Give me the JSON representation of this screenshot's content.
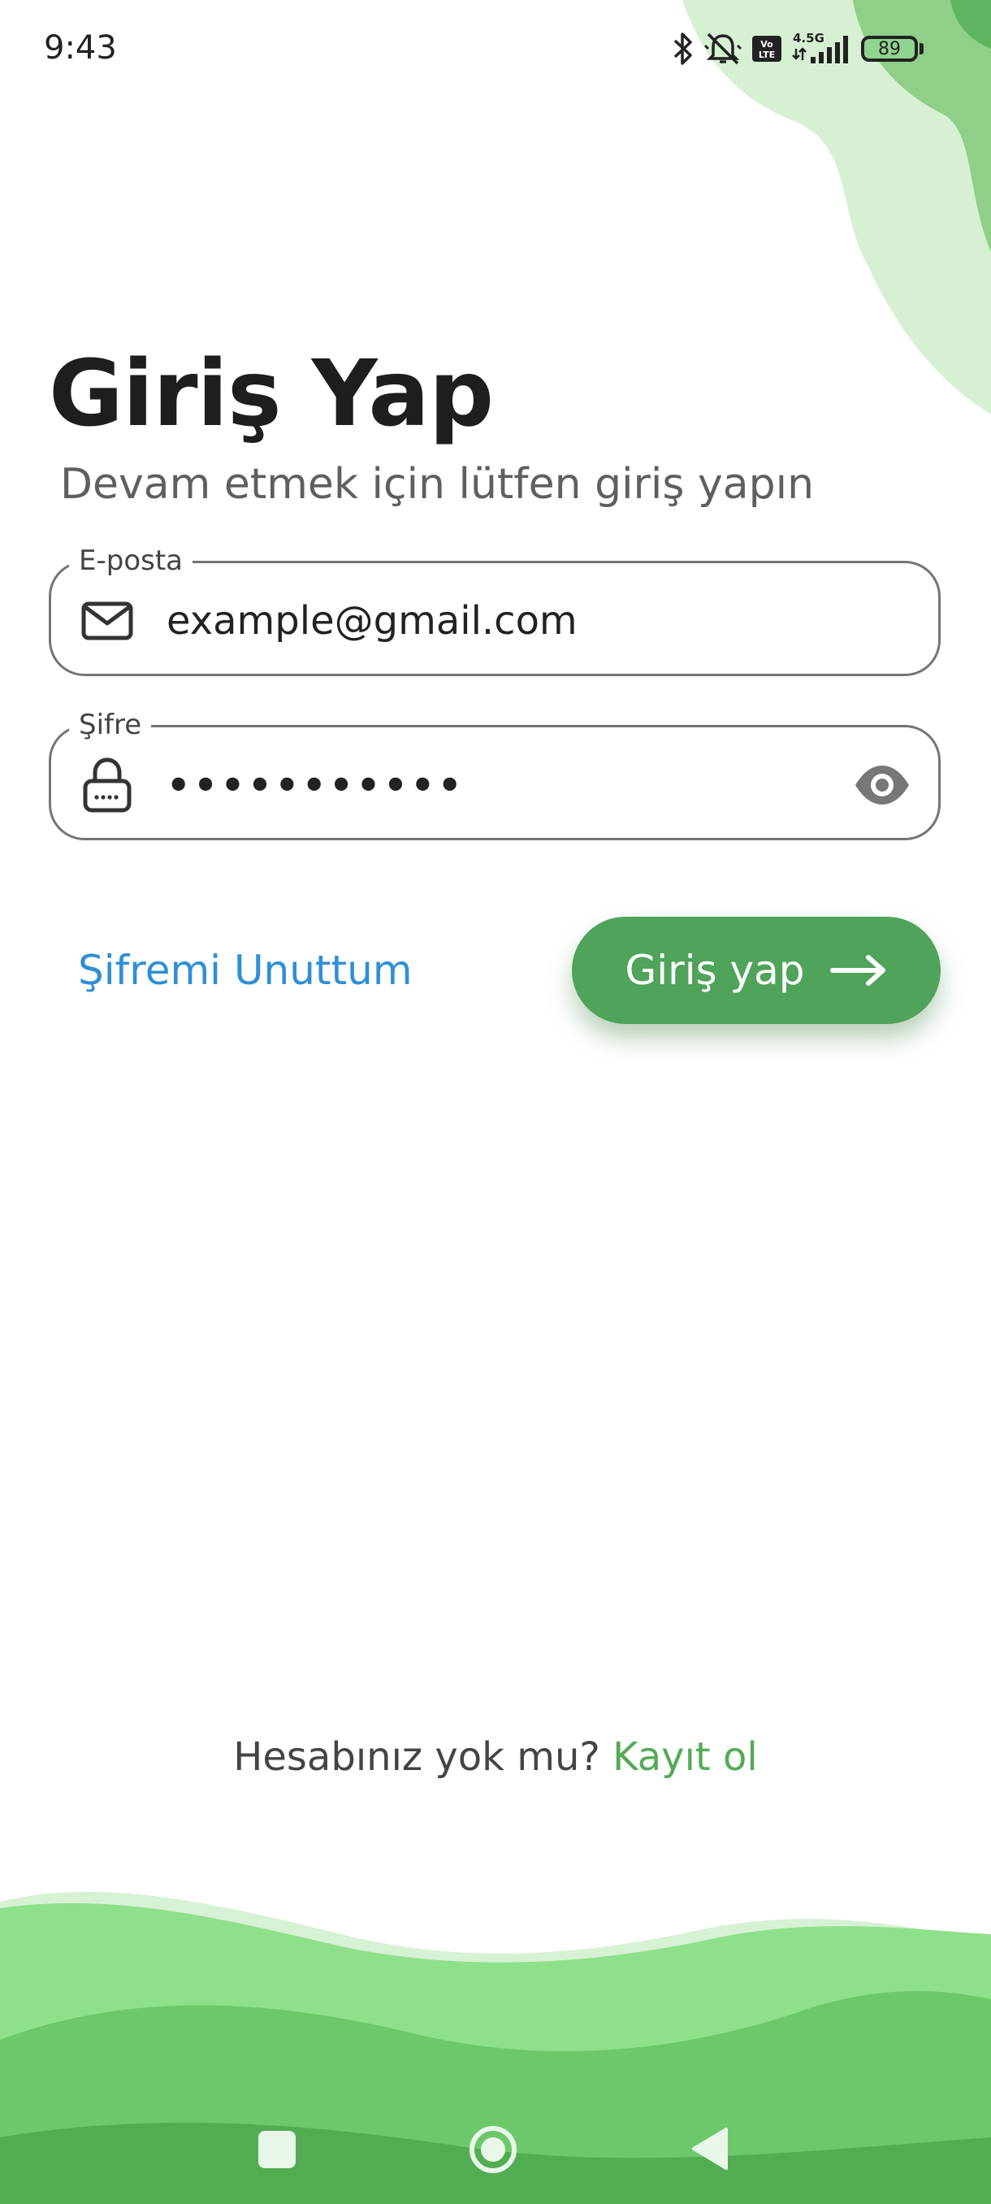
{
  "status_bar": {
    "time": "9:43",
    "battery_level": "89",
    "network_label": "4.5G",
    "volte_label": "Vo LTE"
  },
  "login": {
    "title": "Giriş Yap",
    "subtitle": "Devam etmek için lütfen giriş yapın",
    "email": {
      "label": "E-posta",
      "value": "example@gmail.com",
      "icon": "mail-icon"
    },
    "password": {
      "label": "Şifre",
      "value": "•••••••••••",
      "icon": "lock-icon",
      "toggle_icon": "eye-icon"
    },
    "forgot_password_label": "Şifremi Unuttum",
    "submit_label": "Giriş yap",
    "submit_icon": "arrow-right-icon"
  },
  "signup": {
    "question": "Hesabınız yok mu?",
    "link_label": "Kayıt ol"
  },
  "colors": {
    "primary_green": "#4fa35a",
    "link_blue": "#2f8fd6",
    "light_green": "#8fe08a",
    "pale_green": "#d7f0d4"
  },
  "nav_bar": {
    "recents_icon": "square-icon",
    "home_icon": "circle-home-icon",
    "back_icon": "triangle-back-icon"
  }
}
